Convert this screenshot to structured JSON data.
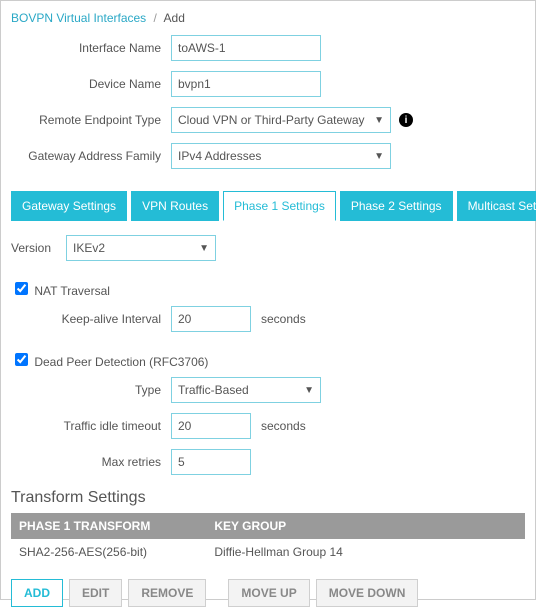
{
  "breadcrumb": {
    "root": "BOVPN Virtual Interfaces",
    "current": "Add"
  },
  "form": {
    "interface_name": {
      "label": "Interface Name",
      "value": "toAWS-1"
    },
    "device_name": {
      "label": "Device Name",
      "value": "bvpn1"
    },
    "remote_endpoint_type": {
      "label": "Remote Endpoint Type",
      "value": "Cloud VPN or Third-Party Gateway"
    },
    "gateway_address_family": {
      "label": "Gateway Address Family",
      "value": "IPv4 Addresses"
    }
  },
  "tabs": [
    {
      "label": "Gateway Settings"
    },
    {
      "label": "VPN Routes"
    },
    {
      "label": "Phase 1 Settings"
    },
    {
      "label": "Phase 2 Settings"
    },
    {
      "label": "Multicast Settings"
    }
  ],
  "phase1": {
    "version": {
      "label": "Version",
      "value": "IKEv2"
    },
    "nat_traversal": {
      "label": "NAT Traversal",
      "checked": true,
      "keepalive": {
        "label": "Keep-alive Interval",
        "value": "20",
        "unit": "seconds"
      }
    },
    "dpd": {
      "label": "Dead Peer Detection (RFC3706)",
      "checked": true,
      "type": {
        "label": "Type",
        "value": "Traffic-Based"
      },
      "idle_timeout": {
        "label": "Traffic idle timeout",
        "value": "20",
        "unit": "seconds"
      },
      "max_retries": {
        "label": "Max retries",
        "value": "5"
      }
    }
  },
  "transform": {
    "title": "Transform Settings",
    "headers": {
      "col1": "PHASE 1 TRANSFORM",
      "col2": "KEY GROUP"
    },
    "rows": [
      {
        "transform": "SHA2-256-AES(256-bit)",
        "keygroup": "Diffie-Hellman Group 14"
      }
    ],
    "buttons": {
      "add": "ADD",
      "edit": "EDIT",
      "remove": "REMOVE",
      "moveup": "MOVE UP",
      "movedown": "MOVE DOWN"
    }
  }
}
